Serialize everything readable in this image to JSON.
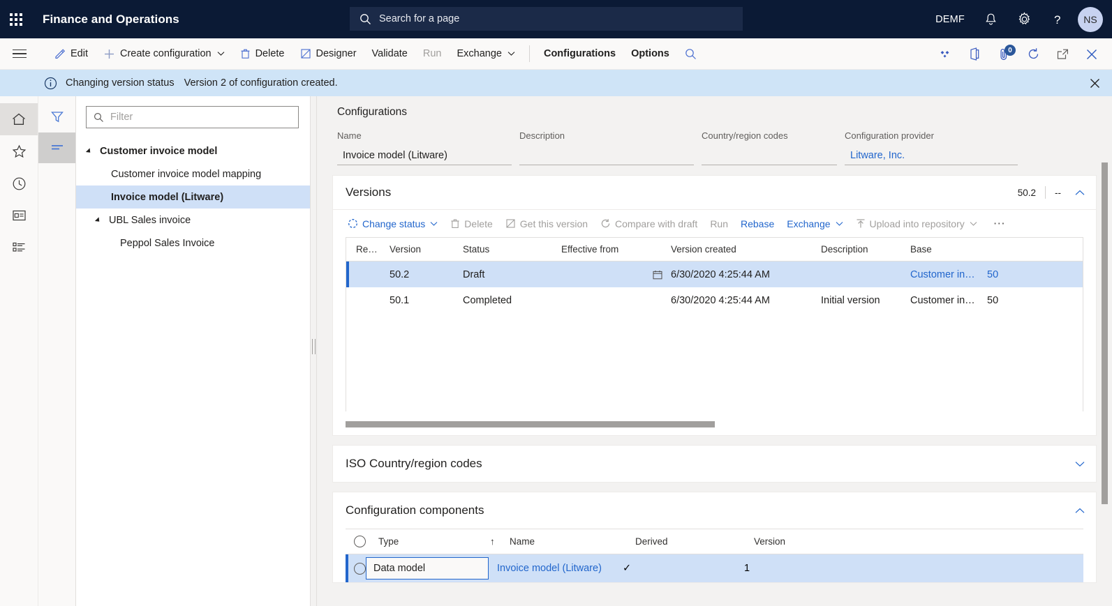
{
  "topbar": {
    "waffle_label": "app-launcher",
    "app_title": "Finance and Operations",
    "search_placeholder": "Search for a page",
    "company": "DEMF",
    "avatar_initials": "NS"
  },
  "commandbar": {
    "items": [
      {
        "label": "Edit",
        "icon": "pencil-icon",
        "disabled": false,
        "caret": false,
        "bold": false
      },
      {
        "label": "Create configuration",
        "icon": "plus-icon",
        "disabled": false,
        "caret": true,
        "bold": false
      },
      {
        "label": "Delete",
        "icon": "trash-icon",
        "disabled": false,
        "caret": false,
        "bold": false
      },
      {
        "label": "Designer",
        "icon": "designer-icon",
        "disabled": false,
        "caret": false,
        "bold": false
      },
      {
        "label": "Validate",
        "icon": "none",
        "disabled": false,
        "caret": false,
        "bold": false
      },
      {
        "label": "Run",
        "icon": "none",
        "disabled": true,
        "caret": false,
        "bold": false
      },
      {
        "label": "Exchange",
        "icon": "none",
        "disabled": false,
        "caret": true,
        "bold": false
      },
      {
        "label": "Configurations",
        "icon": "none",
        "disabled": false,
        "caret": false,
        "bold": true
      },
      {
        "label": "Options",
        "icon": "none",
        "disabled": false,
        "caret": false,
        "bold": true
      }
    ],
    "right_icons": [
      "personalize-icon",
      "office-app-icon",
      "attachment-icon",
      "refresh-icon",
      "popout-icon",
      "close-icon"
    ],
    "attachment_badge": "0"
  },
  "message": {
    "icon": "info-icon",
    "title": "Changing version status",
    "text": "Version 2 of configuration created.",
    "close_label": "close-message"
  },
  "rail": {
    "items": [
      "hamburger-icon",
      "home-icon",
      "favorites-star-icon",
      "recent-clock-icon",
      "workspaces-icon",
      "modules-list-icon"
    ]
  },
  "treetabs": {
    "items": [
      {
        "icon": "filter-icon",
        "active": false
      },
      {
        "icon": "list-lines-icon",
        "active": true
      }
    ]
  },
  "treepanel": {
    "filter_placeholder": "Filter",
    "nodes": [
      {
        "label": "Customer invoice model",
        "level": 0,
        "expander": true,
        "selected": false,
        "bold": true
      },
      {
        "label": "Customer invoice model mapping",
        "level": 1,
        "expander": false,
        "selected": false,
        "bold": false
      },
      {
        "label": "Invoice model (Litware)",
        "level": 1,
        "expander": false,
        "selected": true,
        "bold": true
      },
      {
        "label": "UBL Sales invoice",
        "level": 0,
        "expander": true,
        "selected": false,
        "bold": false
      },
      {
        "label": "Peppol Sales Invoice",
        "level": 2,
        "expander": false,
        "selected": false,
        "bold": false
      }
    ]
  },
  "form": {
    "section_title": "Configurations",
    "fields": [
      {
        "label": "Name",
        "value": "Invoice model (Litware)",
        "link": false
      },
      {
        "label": "Description",
        "value": "",
        "link": false
      },
      {
        "label": "Country/region codes",
        "value": "",
        "link": false
      },
      {
        "label": "Configuration provider",
        "value": "Litware, Inc.",
        "link": true
      }
    ]
  },
  "versions": {
    "title": "Versions",
    "summary_value": "50.2",
    "summary_dash": "--",
    "collapse_icon": "chevron-up-icon",
    "toolbar": [
      {
        "label": "Change status",
        "icon": "status-circle-icon",
        "disabled": false,
        "caret": true,
        "dark": false
      },
      {
        "label": "Delete",
        "icon": "trash-icon",
        "disabled": true,
        "caret": false,
        "dark": false
      },
      {
        "label": "Get this version",
        "icon": "get-version-icon",
        "disabled": true,
        "caret": false,
        "dark": false
      },
      {
        "label": "Compare with draft",
        "icon": "compare-icon",
        "disabled": true,
        "caret": false,
        "dark": false
      },
      {
        "label": "Run",
        "icon": "none",
        "disabled": true,
        "caret": false,
        "dark": false
      },
      {
        "label": "Rebase",
        "icon": "none",
        "disabled": false,
        "caret": false,
        "dark": false
      },
      {
        "label": "Exchange",
        "icon": "none",
        "disabled": false,
        "caret": true,
        "dark": false
      },
      {
        "label": "Upload into repository",
        "icon": "upload-icon",
        "disabled": true,
        "caret": true,
        "dark": false
      }
    ],
    "overflow_label": "⋯",
    "columns": [
      "Re…",
      "Version",
      "Status",
      "Effective from",
      "Version created",
      "Description",
      "Base",
      ""
    ],
    "rows": [
      {
        "re": "",
        "version": "50.2",
        "status": "Draft",
        "effective_from": "",
        "effective_icon": "calendar-icon",
        "version_created": "6/30/2020 4:25:44 AM",
        "description": "",
        "base": "Customer in…",
        "base_num": "50",
        "selected": true
      },
      {
        "re": "",
        "version": "50.1",
        "status": "Completed",
        "effective_from": "",
        "effective_icon": "",
        "version_created": "6/30/2020 4:25:44 AM",
        "description": "Initial version",
        "base": "Customer in…",
        "base_num": "50",
        "selected": false
      }
    ]
  },
  "iso_section": {
    "title": "ISO Country/region codes",
    "collapse_icon": "chevron-down-icon"
  },
  "components_section": {
    "title": "Configuration components",
    "collapse_icon": "chevron-up-icon",
    "columns": [
      "Type",
      "Name",
      "Derived",
      "Version"
    ],
    "sort_indicator": "↑",
    "rows": [
      {
        "type": "Data model",
        "name": "Invoice model (Litware)",
        "derived": "✓",
        "version": "1",
        "selected": true
      }
    ]
  }
}
